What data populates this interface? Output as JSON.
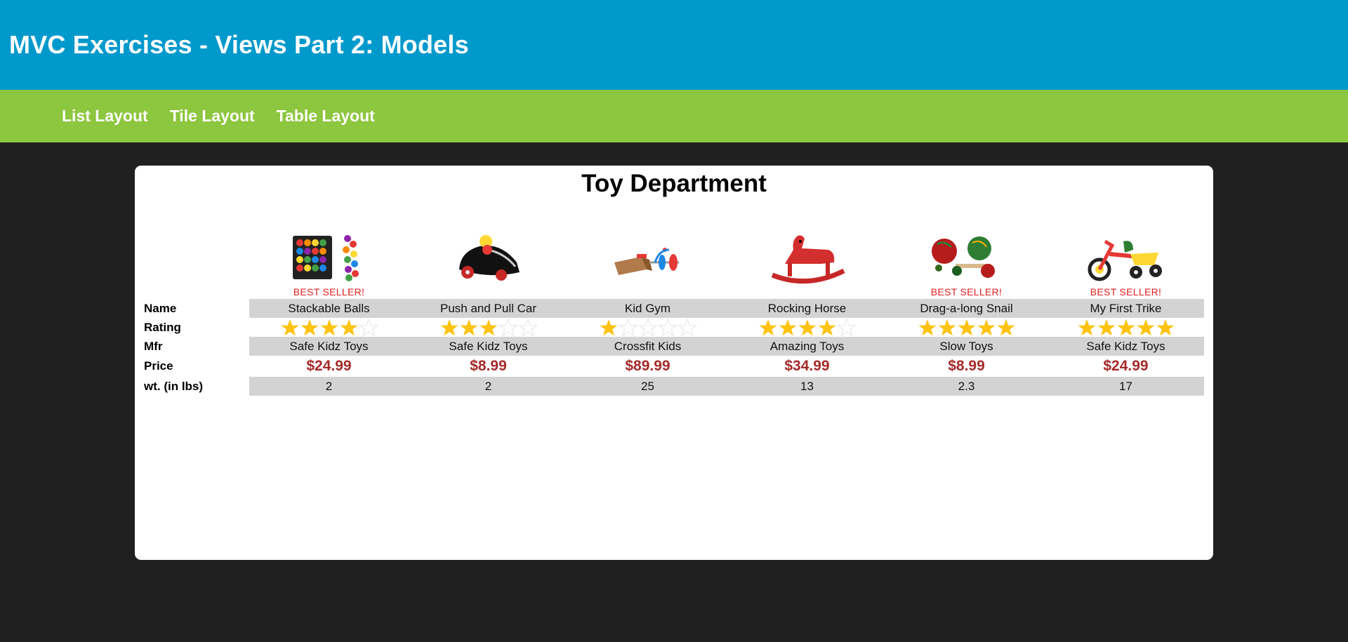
{
  "header": {
    "title": "MVC Exercises - Views Part 2: Models"
  },
  "nav": {
    "items": [
      {
        "label": "List Layout"
      },
      {
        "label": "Tile Layout"
      },
      {
        "label": "Table Layout"
      }
    ]
  },
  "panel": {
    "title": "Toy Department"
  },
  "labels": {
    "name": "Name",
    "rating": "Rating",
    "mfr": "Mfr",
    "price": "Price",
    "weight": "wt. (in lbs)"
  },
  "best_seller_label": "BEST SELLER!",
  "colors": {
    "header": "#0099cc",
    "nav": "#8dc63f",
    "price": "#a52a2a",
    "star": "#ffc20e",
    "best_seller": "#e02020"
  },
  "toys": [
    {
      "name": "Stackable Balls",
      "rating": 4,
      "mfr": "Safe Kidz Toys",
      "price": "$24.99",
      "weight": "2",
      "best_seller": true,
      "icon": "stackable-balls-icon"
    },
    {
      "name": "Push and Pull Car",
      "rating": 3,
      "mfr": "Safe Kidz Toys",
      "price": "$8.99",
      "weight": "2",
      "best_seller": false,
      "icon": "push-pull-car-icon"
    },
    {
      "name": "Kid Gym",
      "rating": 1,
      "mfr": "Crossfit Kids",
      "price": "$89.99",
      "weight": "25",
      "best_seller": false,
      "icon": "kid-gym-icon"
    },
    {
      "name": "Rocking Horse",
      "rating": 4,
      "mfr": "Amazing Toys",
      "price": "$34.99",
      "weight": "13",
      "best_seller": false,
      "icon": "rocking-horse-icon"
    },
    {
      "name": "Drag-a-long Snail",
      "rating": 5,
      "mfr": "Slow Toys",
      "price": "$8.99",
      "weight": "2.3",
      "best_seller": true,
      "icon": "snail-toy-icon"
    },
    {
      "name": "My First Trike",
      "rating": 5,
      "mfr": "Safe Kidz Toys",
      "price": "$24.99",
      "weight": "17",
      "best_seller": true,
      "icon": "trike-icon"
    }
  ]
}
